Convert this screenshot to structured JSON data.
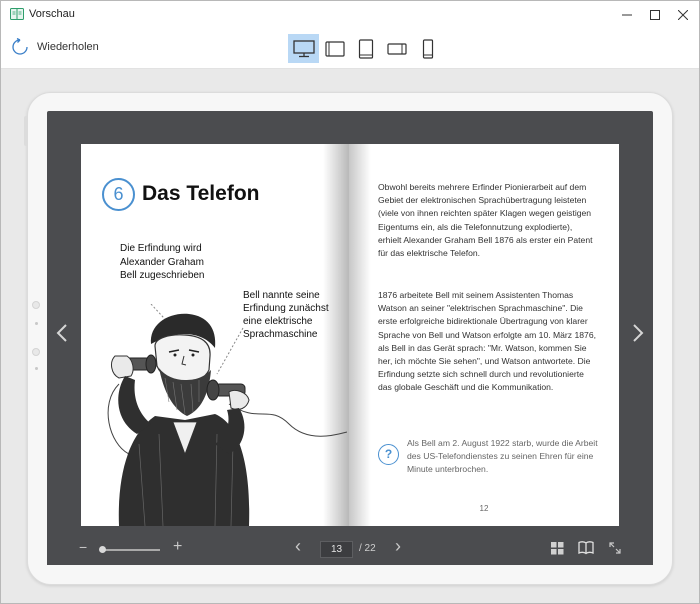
{
  "window": {
    "title": "Vorschau",
    "minimize_icon": "minimize-icon",
    "maximize_icon": "maximize-icon",
    "close_icon": "close-icon"
  },
  "toolbar": {
    "reload_label": "Wiederholen",
    "devices": [
      {
        "name": "desktop",
        "active": true
      },
      {
        "name": "tablet-landscape",
        "active": false
      },
      {
        "name": "tablet-portrait",
        "active": false
      },
      {
        "name": "phone-landscape",
        "active": false
      },
      {
        "name": "phone-portrait",
        "active": false
      }
    ]
  },
  "book": {
    "left_page": {
      "chapter_number": "6",
      "chapter_title": "Das Telefon",
      "note1": "Die Erfindung wird Alexander Graham Bell zugeschrieben",
      "note2": "Bell nannte seine Erfindung zunächst eine elektrische Sprachmaschine"
    },
    "right_page": {
      "paragraph1": "Obwohl bereits mehrere Erfinder Pionierarbeit auf dem Gebiet der elektronischen Sprachübertragung leisteten (viele von ihnen reichten später Klagen wegen geistigen Eigentums ein, als die Telefonnutzung explodierte), erhielt Alexander Graham Bell 1876 als erster ein Patent für das elektrische Telefon.",
      "paragraph2": "1876 arbeitete Bell mit seinem Assistenten Thomas Watson an seiner \"elektrischen Sprachmaschine\". Die erste erfolgreiche bidirektionale Übertragung von klarer Sprache von Bell und Watson erfolgte am 10. März 1876, als Bell in das Gerät sprach: \"Mr. Watson, kommen Sie her, ich möchte Sie sehen\", und Watson antwortete. Die Erfindung setzte sich schnell durch und revolutionierte das globale Geschäft und die Kommunikation.",
      "info_text": "Als Bell am 2. August 1922 starb, wurde die Arbeit des US-Telefondienstes zu seinen Ehren für eine Minute unterbrochen.",
      "info_symbol": "?",
      "page_number": "12"
    }
  },
  "controls": {
    "zoom_out": "−",
    "zoom_in": "+",
    "zoom_level": 0.05,
    "current_page": "13",
    "total_pages": "/ 22",
    "prev_page": "‹",
    "next_page": "›"
  }
}
